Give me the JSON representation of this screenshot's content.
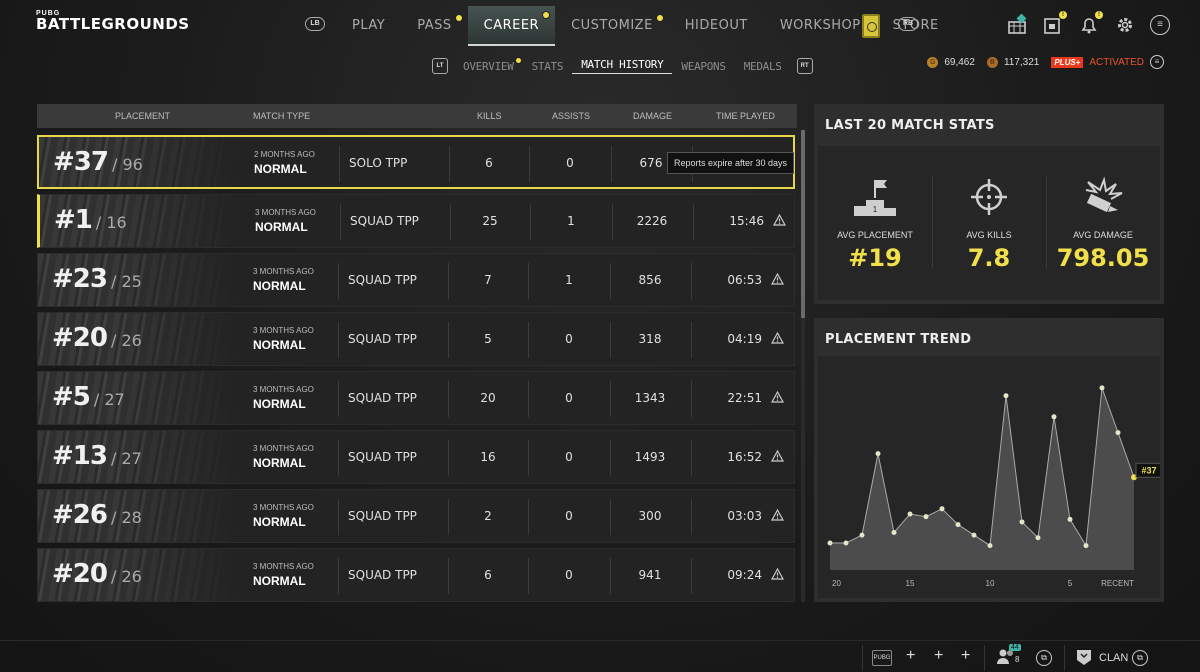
{
  "logo": {
    "small": "PUBG",
    "big": "BATTLEGROUNDS"
  },
  "main_nav": {
    "lb": "LB",
    "rb": "RB",
    "items": [
      {
        "label": "PLAY"
      },
      {
        "label": "PASS"
      },
      {
        "label": "CAREER"
      },
      {
        "label": "CUSTOMIZE"
      },
      {
        "label": "HIDEOUT"
      },
      {
        "label": "WORKSHOP"
      },
      {
        "label": "STORE"
      }
    ],
    "active": "CAREER"
  },
  "sub_nav": {
    "lt": "LT",
    "rt": "RT",
    "items": [
      {
        "label": "OVERVIEW"
      },
      {
        "label": "STATS"
      },
      {
        "label": "MATCH HISTORY"
      },
      {
        "label": "WEAPONS"
      },
      {
        "label": "MEDALS"
      }
    ],
    "active": "MATCH HISTORY"
  },
  "currency": {
    "g_coin": "69,462",
    "bp": "117,321",
    "plus_tag": "PLUS+",
    "plus_status": "ACTIVATED"
  },
  "table": {
    "headers": {
      "placement": "PLACEMENT",
      "match_type": "MATCH TYPE",
      "kills": "KILLS",
      "assists": "ASSISTS",
      "damage": "DAMAGE",
      "time_played": "TIME PLAYED"
    },
    "rows": [
      {
        "place": "#37",
        "total": "/ 96",
        "ago": "2 MONTHS AGO",
        "mode": "NORMAL",
        "type": "SOLO TPP",
        "kills": "6",
        "assists": "0",
        "damage": "676",
        "time": "",
        "tooltip": "Reports expire after 30 days"
      },
      {
        "place": "#1",
        "total": "/ 16",
        "ago": "3 MONTHS AGO",
        "mode": "NORMAL",
        "type": "SQUAD TPP",
        "kills": "25",
        "assists": "1",
        "damage": "2226",
        "time": "15:46"
      },
      {
        "place": "#23",
        "total": "/ 25",
        "ago": "3 MONTHS AGO",
        "mode": "NORMAL",
        "type": "SQUAD TPP",
        "kills": "7",
        "assists": "1",
        "damage": "856",
        "time": "06:53"
      },
      {
        "place": "#20",
        "total": "/ 26",
        "ago": "3 MONTHS AGO",
        "mode": "NORMAL",
        "type": "SQUAD TPP",
        "kills": "5",
        "assists": "0",
        "damage": "318",
        "time": "04:19"
      },
      {
        "place": "#5",
        "total": "/ 27",
        "ago": "3 MONTHS AGO",
        "mode": "NORMAL",
        "type": "SQUAD TPP",
        "kills": "20",
        "assists": "0",
        "damage": "1343",
        "time": "22:51"
      },
      {
        "place": "#13",
        "total": "/ 27",
        "ago": "3 MONTHS AGO",
        "mode": "NORMAL",
        "type": "SQUAD TPP",
        "kills": "16",
        "assists": "0",
        "damage": "1493",
        "time": "16:52"
      },
      {
        "place": "#26",
        "total": "/ 28",
        "ago": "3 MONTHS AGO",
        "mode": "NORMAL",
        "type": "SQUAD TPP",
        "kills": "2",
        "assists": "0",
        "damage": "300",
        "time": "03:03"
      },
      {
        "place": "#20",
        "total": "/ 26",
        "ago": "3 MONTHS AGO",
        "mode": "NORMAL",
        "type": "SQUAD TPP",
        "kills": "6",
        "assists": "0",
        "damage": "941",
        "time": "09:24"
      }
    ]
  },
  "stats": {
    "title": "LAST 20 MATCH STATS",
    "items": [
      {
        "label": "AVG PLACEMENT",
        "value": "#19",
        "icon": "podium-icon"
      },
      {
        "label": "AVG KILLS",
        "value": "7.8",
        "icon": "crosshair-icon"
      },
      {
        "label": "AVG DAMAGE",
        "value": "798.05",
        "icon": "bullet-impact-icon"
      }
    ]
  },
  "trend": {
    "title": "PLACEMENT TREND",
    "current_label": "#37",
    "x_ticks": [
      "20",
      "15",
      "10",
      "5",
      "RECENT"
    ]
  },
  "chart_data": {
    "type": "area",
    "title": "PLACEMENT TREND",
    "x": [
      20,
      19,
      18,
      17,
      16,
      15,
      14,
      13,
      12,
      11,
      10,
      9,
      8,
      7,
      6,
      5,
      4,
      3,
      2,
      1
    ],
    "x_tick_labels": [
      "20",
      "15",
      "10",
      "5",
      "RECENT"
    ],
    "series": [
      {
        "values": [
          62,
          62,
          59,
          28,
          58,
          51,
          52,
          49,
          55,
          59,
          63,
          6,
          54,
          60,
          14,
          53,
          63,
          3,
          20,
          37
        ]
      }
    ],
    "y_axis": "placement (lower is better), inverted",
    "ylim": [
      70,
      0
    ],
    "grid": false,
    "highlight": {
      "label": "#37",
      "point": "latest"
    },
    "accent": "#f2e04a"
  },
  "bottom": {
    "party_count": "44",
    "party_sub": "8",
    "clan": "CLAN",
    "plus": "+"
  },
  "colors": {
    "accent": "#f2e04a",
    "plus": "#e8391e",
    "background": "#1b1b1b"
  }
}
